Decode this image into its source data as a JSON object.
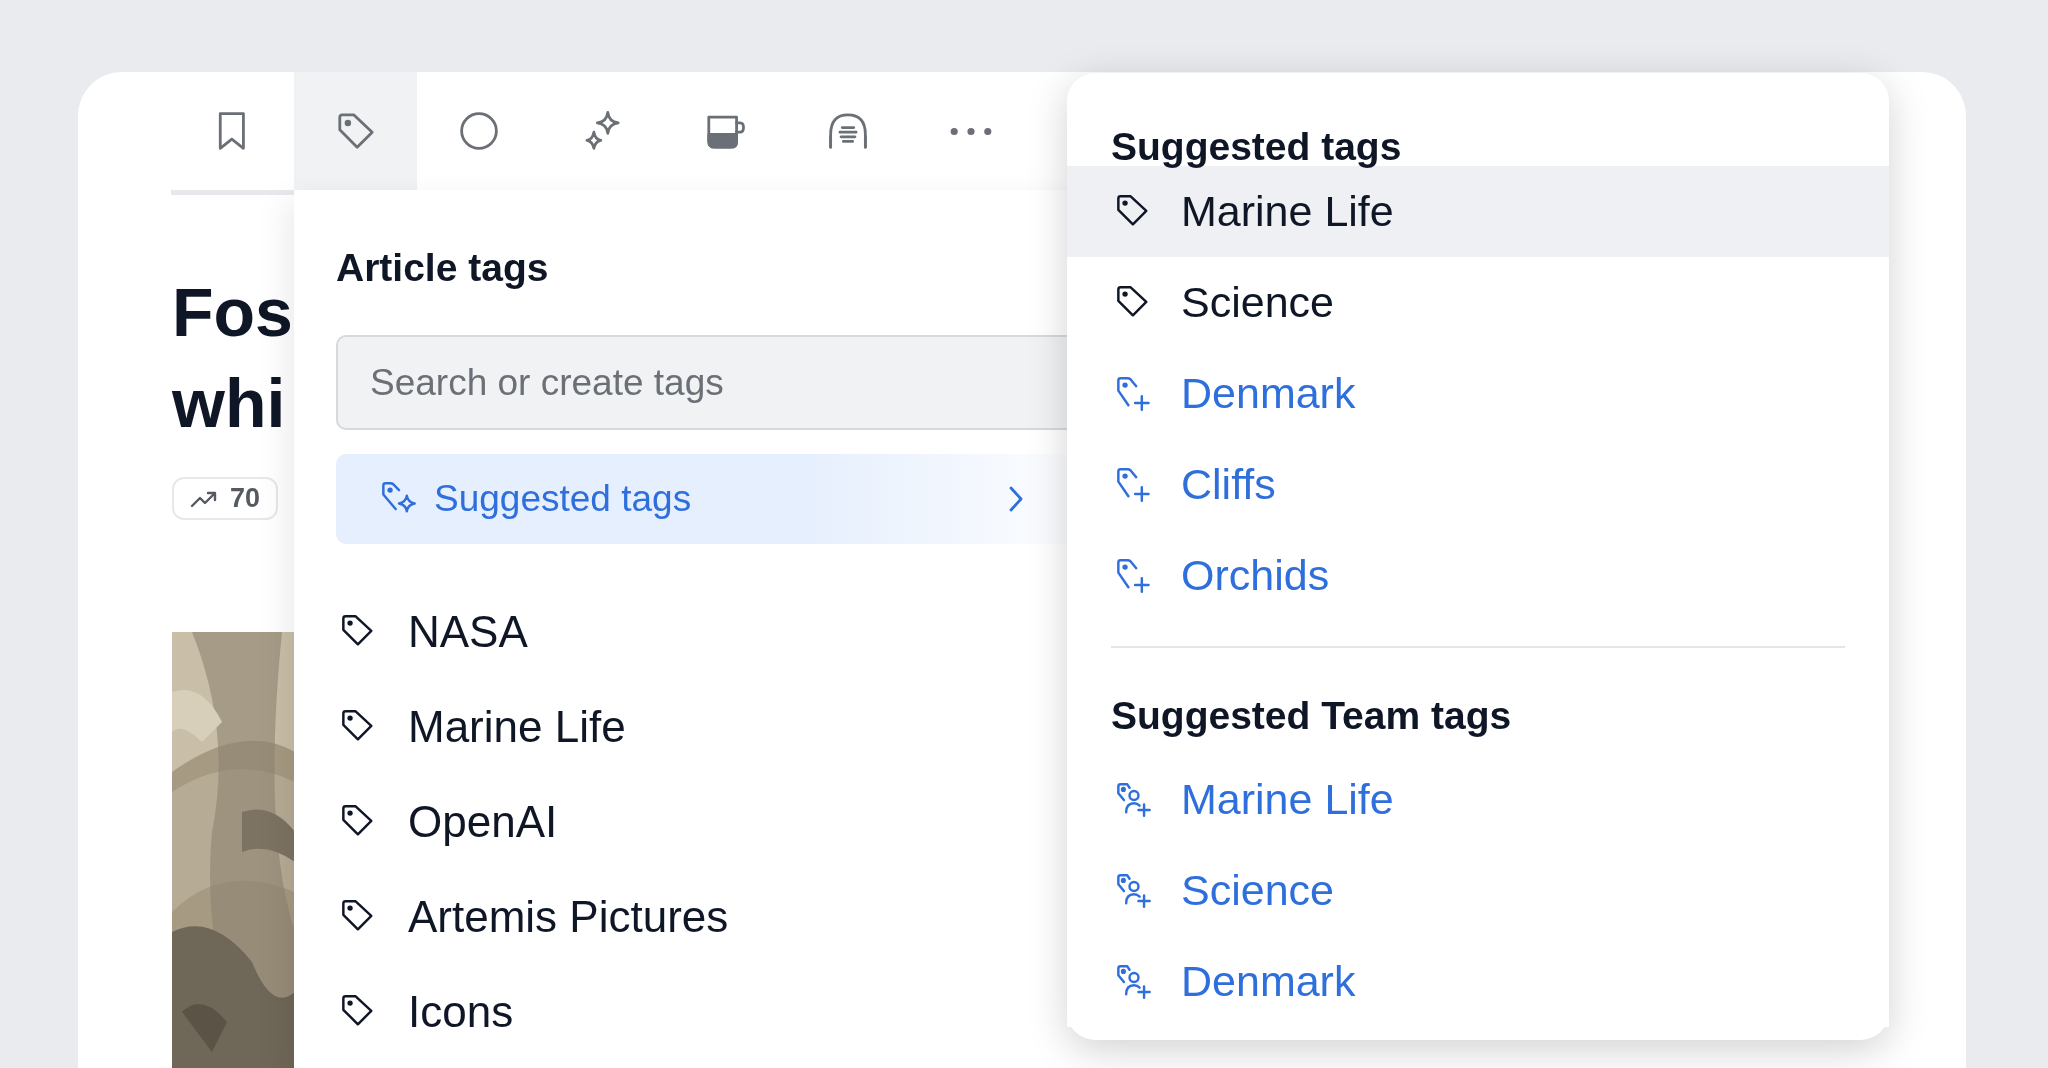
{
  "toolbar": [
    {
      "kind": "bookmark",
      "selected": false
    },
    {
      "kind": "tag",
      "selected": true
    },
    {
      "kind": "circle",
      "selected": false
    },
    {
      "kind": "sparkles",
      "selected": false
    },
    {
      "kind": "mug",
      "selected": false
    },
    {
      "kind": "headphones",
      "selected": false
    },
    {
      "kind": "more",
      "selected": false
    }
  ],
  "article": {
    "title_lines": [
      "Fos",
      "whi"
    ],
    "badge": "70",
    "image": {
      "kind": "picture"
    }
  },
  "article_tags": {
    "heading": "Article tags",
    "search": {
      "placeholder": "Search or create tags"
    },
    "suggested_link": "Suggested tags",
    "tags": [
      "NASA",
      "Marine Life",
      "OpenAI",
      "Artemis Pictures",
      "Icons"
    ]
  },
  "suggestions": [
    {
      "heading": "Suggested tags",
      "items": [
        {
          "label": "Marine Life",
          "kind": "applied",
          "selected": true
        },
        {
          "label": "Science",
          "kind": "applied",
          "selected": false
        },
        {
          "label": "Denmark",
          "kind": "new",
          "selected": false
        },
        {
          "label": "Cliffs",
          "kind": "new",
          "selected": false
        },
        {
          "label": "Orchids",
          "kind": "new",
          "selected": false
        }
      ]
    },
    {
      "heading": "Suggested Team tags",
      "items": [
        {
          "label": "Marine Life",
          "kind": "team",
          "selected": false
        },
        {
          "label": "Science",
          "kind": "team",
          "selected": false
        },
        {
          "label": "Denmark",
          "kind": "team",
          "selected": false
        }
      ]
    }
  ]
}
